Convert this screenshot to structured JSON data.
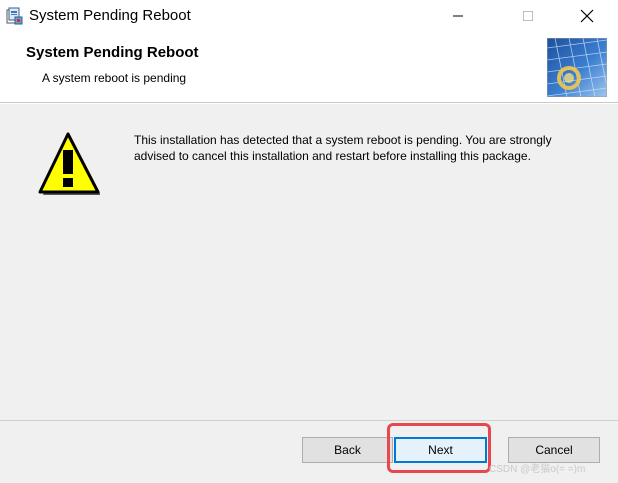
{
  "window": {
    "title": "System Pending Reboot",
    "controls": {
      "minimize": "minimize-icon",
      "maximize": "maximize-icon",
      "close": "close-icon"
    }
  },
  "banner": {
    "title": "System Pending Reboot",
    "subtitle": "A system reboot is pending"
  },
  "body": {
    "icon": "warning-icon",
    "message": "This installation has detected that a system reboot is pending.  You are strongly advised to cancel this installation and restart before installing this package."
  },
  "buttons": {
    "back": "Back",
    "next": "Next",
    "cancel": "Cancel"
  },
  "annotation": {
    "highlight_color": "#e5484d"
  },
  "watermark": "CSDN @老猫o(= =)m",
  "colors": {
    "focus_border": "#0078d7",
    "warning_yellow": "#ffff00"
  }
}
